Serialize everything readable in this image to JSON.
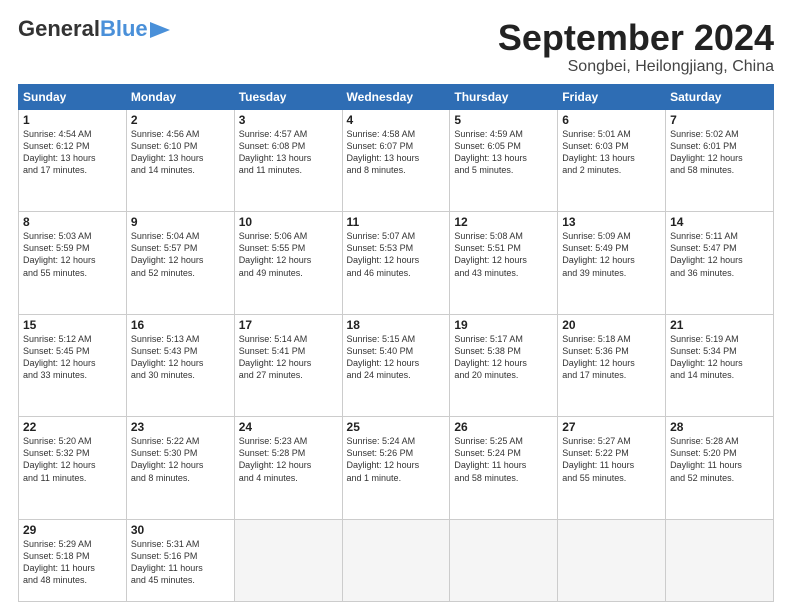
{
  "header": {
    "logo_line1": "General",
    "logo_line2": "Blue",
    "month_title": "September 2024",
    "location": "Songbei, Heilongjiang, China"
  },
  "weekdays": [
    "Sunday",
    "Monday",
    "Tuesday",
    "Wednesday",
    "Thursday",
    "Friday",
    "Saturday"
  ],
  "weeks": [
    [
      {
        "day": "1",
        "info": "Sunrise: 4:54 AM\nSunset: 6:12 PM\nDaylight: 13 hours\nand 17 minutes."
      },
      {
        "day": "2",
        "info": "Sunrise: 4:56 AM\nSunset: 6:10 PM\nDaylight: 13 hours\nand 14 minutes."
      },
      {
        "day": "3",
        "info": "Sunrise: 4:57 AM\nSunset: 6:08 PM\nDaylight: 13 hours\nand 11 minutes."
      },
      {
        "day": "4",
        "info": "Sunrise: 4:58 AM\nSunset: 6:07 PM\nDaylight: 13 hours\nand 8 minutes."
      },
      {
        "day": "5",
        "info": "Sunrise: 4:59 AM\nSunset: 6:05 PM\nDaylight: 13 hours\nand 5 minutes."
      },
      {
        "day": "6",
        "info": "Sunrise: 5:01 AM\nSunset: 6:03 PM\nDaylight: 13 hours\nand 2 minutes."
      },
      {
        "day": "7",
        "info": "Sunrise: 5:02 AM\nSunset: 6:01 PM\nDaylight: 12 hours\nand 58 minutes."
      }
    ],
    [
      {
        "day": "8",
        "info": "Sunrise: 5:03 AM\nSunset: 5:59 PM\nDaylight: 12 hours\nand 55 minutes."
      },
      {
        "day": "9",
        "info": "Sunrise: 5:04 AM\nSunset: 5:57 PM\nDaylight: 12 hours\nand 52 minutes."
      },
      {
        "day": "10",
        "info": "Sunrise: 5:06 AM\nSunset: 5:55 PM\nDaylight: 12 hours\nand 49 minutes."
      },
      {
        "day": "11",
        "info": "Sunrise: 5:07 AM\nSunset: 5:53 PM\nDaylight: 12 hours\nand 46 minutes."
      },
      {
        "day": "12",
        "info": "Sunrise: 5:08 AM\nSunset: 5:51 PM\nDaylight: 12 hours\nand 43 minutes."
      },
      {
        "day": "13",
        "info": "Sunrise: 5:09 AM\nSunset: 5:49 PM\nDaylight: 12 hours\nand 39 minutes."
      },
      {
        "day": "14",
        "info": "Sunrise: 5:11 AM\nSunset: 5:47 PM\nDaylight: 12 hours\nand 36 minutes."
      }
    ],
    [
      {
        "day": "15",
        "info": "Sunrise: 5:12 AM\nSunset: 5:45 PM\nDaylight: 12 hours\nand 33 minutes."
      },
      {
        "day": "16",
        "info": "Sunrise: 5:13 AM\nSunset: 5:43 PM\nDaylight: 12 hours\nand 30 minutes."
      },
      {
        "day": "17",
        "info": "Sunrise: 5:14 AM\nSunset: 5:41 PM\nDaylight: 12 hours\nand 27 minutes."
      },
      {
        "day": "18",
        "info": "Sunrise: 5:15 AM\nSunset: 5:40 PM\nDaylight: 12 hours\nand 24 minutes."
      },
      {
        "day": "19",
        "info": "Sunrise: 5:17 AM\nSunset: 5:38 PM\nDaylight: 12 hours\nand 20 minutes."
      },
      {
        "day": "20",
        "info": "Sunrise: 5:18 AM\nSunset: 5:36 PM\nDaylight: 12 hours\nand 17 minutes."
      },
      {
        "day": "21",
        "info": "Sunrise: 5:19 AM\nSunset: 5:34 PM\nDaylight: 12 hours\nand 14 minutes."
      }
    ],
    [
      {
        "day": "22",
        "info": "Sunrise: 5:20 AM\nSunset: 5:32 PM\nDaylight: 12 hours\nand 11 minutes."
      },
      {
        "day": "23",
        "info": "Sunrise: 5:22 AM\nSunset: 5:30 PM\nDaylight: 12 hours\nand 8 minutes."
      },
      {
        "day": "24",
        "info": "Sunrise: 5:23 AM\nSunset: 5:28 PM\nDaylight: 12 hours\nand 4 minutes."
      },
      {
        "day": "25",
        "info": "Sunrise: 5:24 AM\nSunset: 5:26 PM\nDaylight: 12 hours\nand 1 minute."
      },
      {
        "day": "26",
        "info": "Sunrise: 5:25 AM\nSunset: 5:24 PM\nDaylight: 11 hours\nand 58 minutes."
      },
      {
        "day": "27",
        "info": "Sunrise: 5:27 AM\nSunset: 5:22 PM\nDaylight: 11 hours\nand 55 minutes."
      },
      {
        "day": "28",
        "info": "Sunrise: 5:28 AM\nSunset: 5:20 PM\nDaylight: 11 hours\nand 52 minutes."
      }
    ],
    [
      {
        "day": "29",
        "info": "Sunrise: 5:29 AM\nSunset: 5:18 PM\nDaylight: 11 hours\nand 48 minutes."
      },
      {
        "day": "30",
        "info": "Sunrise: 5:31 AM\nSunset: 5:16 PM\nDaylight: 11 hours\nand 45 minutes."
      },
      {
        "day": "",
        "info": ""
      },
      {
        "day": "",
        "info": ""
      },
      {
        "day": "",
        "info": ""
      },
      {
        "day": "",
        "info": ""
      },
      {
        "day": "",
        "info": ""
      }
    ]
  ]
}
